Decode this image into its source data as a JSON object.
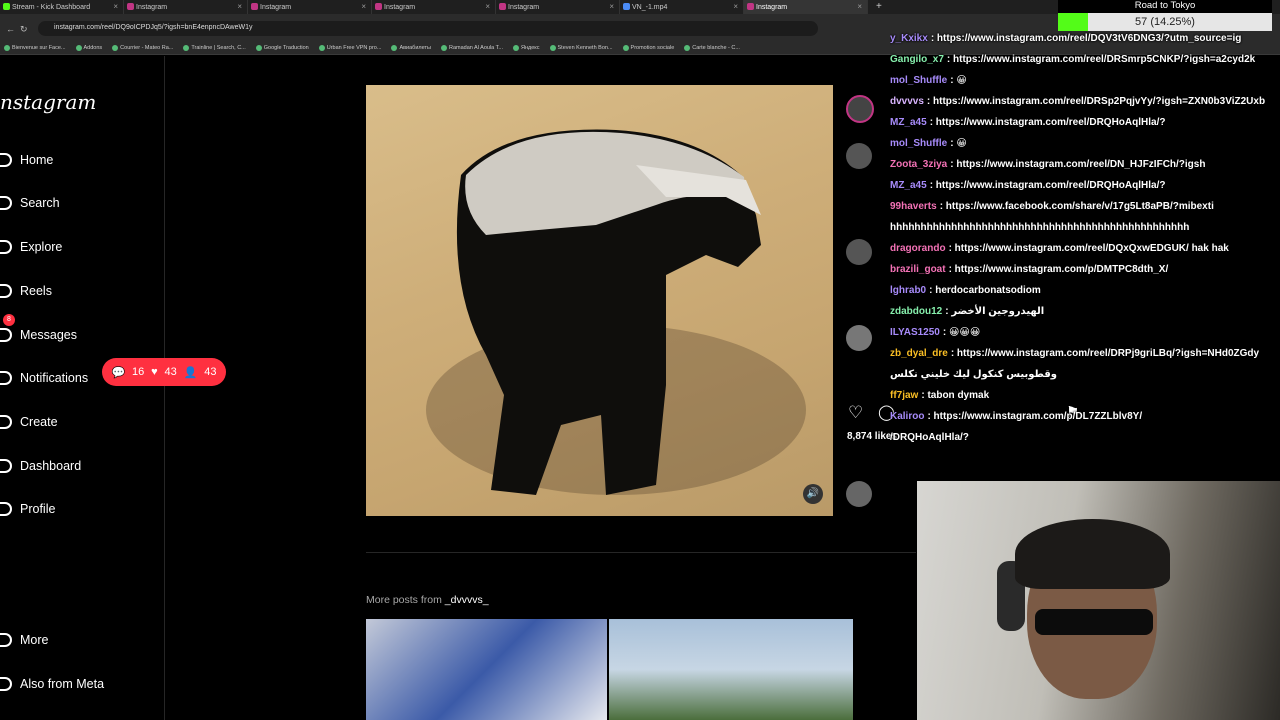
{
  "browser": {
    "tabs": [
      {
        "label": "Stream - Kick Dashboard"
      },
      {
        "label": "Instagram"
      },
      {
        "label": "Instagram"
      },
      {
        "label": "Instagram"
      },
      {
        "label": "Instagram"
      },
      {
        "label": "VN_-1.mp4"
      },
      {
        "label": "Instagram"
      }
    ],
    "new_tab": "+",
    "url": "instagram.com/reel/DQ9oICPDJq5/?igsh=bnE4enpncDAweW1y",
    "bookmarks": [
      "Bienvenue sur Face...",
      "Addons",
      "Courrier - Mateo Ra...",
      "Trainline | Search, C...",
      "Google Traduction",
      "Urban Free VPN pro...",
      "Авиабилеты",
      "Ramadan Al Aoula T...",
      "Яндекс",
      "Steven Kenneth Bon...",
      "Promotion sociale",
      "Carte blanche - C..."
    ]
  },
  "sidebar": {
    "logo": "nstagram",
    "items": [
      {
        "label": "Home"
      },
      {
        "label": "Search"
      },
      {
        "label": "Explore"
      },
      {
        "label": "Reels"
      },
      {
        "label": "Messages",
        "badge": "8"
      },
      {
        "label": "Notifications"
      },
      {
        "label": "Create"
      },
      {
        "label": "Dashboard"
      },
      {
        "label": "Profile"
      },
      {
        "label": "More"
      },
      {
        "label": "Also from Meta"
      }
    ],
    "notif_pill": {
      "comments": "16",
      "likes": "43",
      "follows": "43"
    }
  },
  "post": {
    "likes": "8,874 likes",
    "more_posts_prefix": "More posts from",
    "more_posts_user": "_dvvvvs_"
  },
  "overlay": {
    "goal_title": "Road to Tokyo",
    "goal_text": "57 (14.25%)",
    "goal_percent": 14.25
  },
  "chat": [
    {
      "user": "y_Kxikx",
      "color": "#a78bfa",
      "msg": ": https://www.instagram.com/reel/DQV3tV6DNG3/?utm_source=ig"
    },
    {
      "user": "Gangilo_x7",
      "color": "#86efac",
      "msg": ": https://www.instagram.com/reel/DRSmrp5CNKP/?igsh=a2cyd2k"
    },
    {
      "user": "mol_Shuffle",
      "color": "#a78bfa",
      "msg": ": 😀"
    },
    {
      "user": "dvvvvs",
      "color": "#d8b4fe",
      "msg": ": https://www.instagram.com/reel/DRSp2PqjvYy/?igsh=ZXN0b3ViZ2Uxb"
    },
    {
      "user": "MZ_a45",
      "color": "#a78bfa",
      "msg": ": https://www.instagram.com/reel/DRQHoAqlHla/?"
    },
    {
      "user": "mol_Shuffle",
      "color": "#a78bfa",
      "msg": ": 😀"
    },
    {
      "user": "Zoota_3ziya",
      "color": "#f472b6",
      "msg": ": https://www.instagram.com/reel/DN_HJFzIFCh/?igsh"
    },
    {
      "user": "MZ_a45",
      "color": "#a78bfa",
      "msg": ": https://www.instagram.com/reel/DRQHoAqlHla/?"
    },
    {
      "user": "99haverts",
      "color": "#f472b6",
      "msg": ": https://www.facebook.com/share/v/17g5Lt8aPB/?mibexti"
    },
    {
      "user": "",
      "color": "#ffffff",
      "msg": "hhhhhhhhhhhhhhhhhhhhhhhhhhhhhhhhhhhhhhhhhhhhhhhhh"
    },
    {
      "user": "dragorando",
      "color": "#f472b6",
      "msg": ": https://www.instagram.com/reel/DQxQxwEDGUK/ hak hak"
    },
    {
      "user": "brazili_goat",
      "color": "#f472b6",
      "msg": ": https://www.instagram.com/p/DMTPC8dth_X/"
    },
    {
      "user": "lghrab0",
      "color": "#a78bfa",
      "msg": ": herdocarbonatsodiom"
    },
    {
      "user": "zdabdou12",
      "color": "#86efac",
      "msg": ": الهيدروجين الأخضر"
    },
    {
      "user": "ILYAS1250",
      "color": "#a78bfa",
      "msg": ": 😀😀😀"
    },
    {
      "user": "zb_dyal_dre",
      "color": "#fbbf24",
      "msg": ": https://www.instagram.com/reel/DRPj9griLBq/?igsh=NHd0ZGdy"
    },
    {
      "user": "",
      "color": "#ffffff",
      "msg": "وقطوبيس كنكول ليك خليني نكلس"
    },
    {
      "user": "ff7jaw",
      "color": "#fbbf24",
      "msg": ": tabon dymak"
    },
    {
      "user": "Kaliroo",
      "color": "#a78bfa",
      "msg": ": https://www.instagram.com/p/DL7ZZLblv8Y/"
    },
    {
      "user": "",
      "color": "#ffffff",
      "msg": "/DRQHoAqlHla/?"
    }
  ]
}
